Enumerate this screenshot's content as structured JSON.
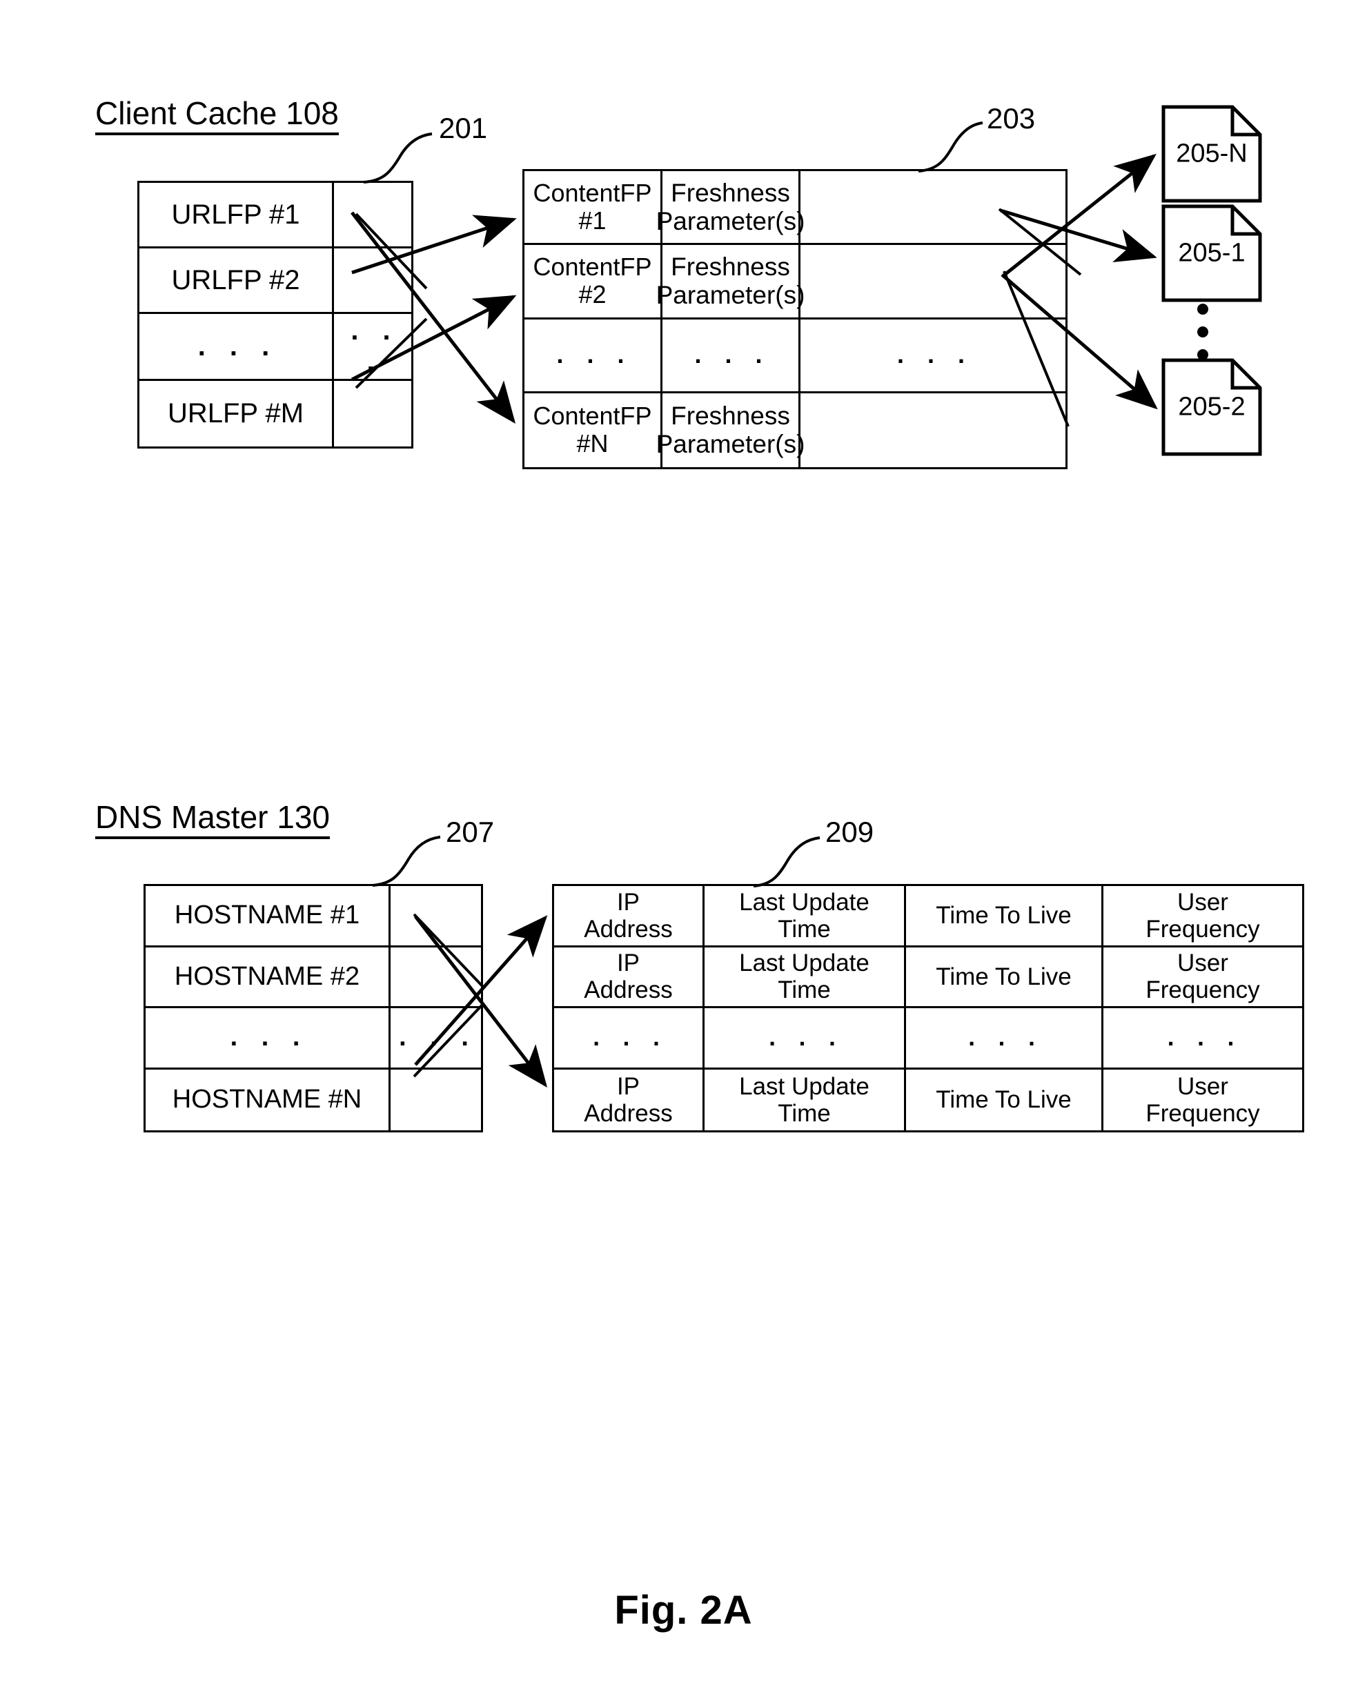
{
  "figure": {
    "caption": "Fig. 2A"
  },
  "sections": [
    {
      "id": "client-cache",
      "title": "Client Cache 108"
    },
    {
      "id": "dns-master",
      "title": "DNS Master 130"
    }
  ],
  "reference_numerals": {
    "table_201": "201",
    "table_203": "203",
    "table_207": "207",
    "table_209": "209"
  },
  "tables": {
    "url_fingerprint_table": {
      "ref": "201",
      "columns": 2,
      "rows": [
        {
          "cells": [
            "URLFP #1",
            ""
          ]
        },
        {
          "cells": [
            "URLFP #2",
            ""
          ]
        },
        {
          "cells": [
            ". . .",
            ". . ."
          ]
        },
        {
          "cells": [
            "URLFP #M",
            ""
          ]
        }
      ]
    },
    "content_fingerprint_table": {
      "ref": "203",
      "columns": 3,
      "rows": [
        {
          "cells": [
            "ContentFP #1",
            "Freshness\nParameter(s)",
            ""
          ]
        },
        {
          "cells": [
            "ContentFP #2",
            "Freshness\nParameter(s)",
            ""
          ]
        },
        {
          "cells": [
            ". . .",
            ". . .",
            ". . ."
          ]
        },
        {
          "cells": [
            "ContentFP #N",
            "Freshness\nParameter(s)",
            ""
          ]
        }
      ]
    },
    "hostname_table": {
      "ref": "207",
      "columns": 2,
      "rows": [
        {
          "cells": [
            "HOSTNAME #1",
            ""
          ]
        },
        {
          "cells": [
            "HOSTNAME #2",
            ""
          ]
        },
        {
          "cells": [
            ". . .",
            ". . ."
          ]
        },
        {
          "cells": [
            "HOSTNAME #N",
            ""
          ]
        }
      ]
    },
    "dns_record_table": {
      "ref": "209",
      "columns": 4,
      "rows": [
        {
          "cells": [
            "IP\nAddress",
            "Last Update\nTime",
            "Time To Live",
            "User\nFrequency"
          ]
        },
        {
          "cells": [
            "IP\nAddress",
            "Last Update\nTime",
            "Time To Live",
            "User\nFrequency"
          ]
        },
        {
          "cells": [
            ". . .",
            ". . .",
            ". . .",
            ". . ."
          ]
        },
        {
          "cells": [
            "IP\nAddress",
            "Last Update\nTime",
            "Time To Live",
            "User\nFrequency"
          ]
        }
      ]
    }
  },
  "documents": [
    {
      "label": "205-N"
    },
    {
      "label": "205-1"
    },
    {
      "label": "205-2"
    }
  ],
  "colors": {
    "ink": "#000000",
    "page": "#ffffff"
  }
}
